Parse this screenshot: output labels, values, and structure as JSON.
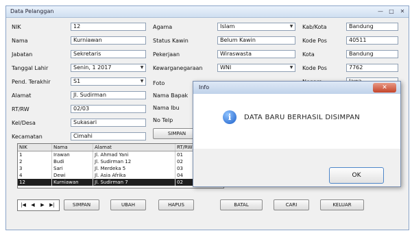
{
  "window": {
    "title": "Data Pelanggan",
    "controls": [
      "—",
      "□",
      "✕"
    ]
  },
  "left_form": {
    "fields": [
      {
        "label": "NIK",
        "value": "12"
      },
      {
        "label": "Nama",
        "value": "Kurniawan"
      },
      {
        "label": "Jabatan",
        "value": "Sekretaris"
      },
      {
        "label": "Tanggal Lahir",
        "value": "Senin, 1 2017"
      },
      {
        "label": "Pend. Terakhir",
        "value": "S1"
      },
      {
        "label": "Alamat",
        "value": "Jl. Sudirman"
      },
      {
        "label": "RT/RW",
        "value": "02/03"
      },
      {
        "label": "Kel/Desa",
        "value": "Sukasari"
      },
      {
        "label": "Kecamatan",
        "value": "Cimahi"
      }
    ]
  },
  "mid_form": {
    "fields": [
      {
        "label": "Agama",
        "value": "Islam"
      },
      {
        "label": "Status Kawin",
        "value": "Belum Kawin"
      },
      {
        "label": "Pekerjaan",
        "value": "Wiraswasta"
      },
      {
        "label": "Kewarganegaraan",
        "value": "WNI"
      },
      {
        "label": "Foto",
        "value": ""
      },
      {
        "label": "Nama Bapak",
        "value": ""
      },
      {
        "label": "Nama Ibu",
        "value": ""
      },
      {
        "label": "No Telp",
        "value": ""
      }
    ],
    "simpan_label": "SIMPAN"
  },
  "right_form": {
    "fields": [
      {
        "label": "Kab/Kota",
        "value": "Bandung"
      },
      {
        "label": "Kode Pos",
        "value": "40511"
      },
      {
        "label": "Kota",
        "value": "Bandung"
      },
      {
        "label": "Kode Pos",
        "value": "7762"
      },
      {
        "label": "Negara",
        "value": "Jawa"
      }
    ]
  },
  "grid": {
    "headers": [
      "NIK",
      "Nama",
      "Alamat",
      "RT/RW"
    ],
    "rows": [
      [
        "1",
        "Irawan",
        "Jl. Ahmad Yani",
        "01"
      ],
      [
        "2",
        "Budi",
        "Jl. Sudirman 12",
        "02"
      ],
      [
        "3",
        "Sari",
        "Jl. Merdeka 5",
        "03"
      ],
      [
        "4",
        "Dewi",
        "Jl. Asia Afrika",
        "04"
      ],
      [
        "12",
        "Kurniawan",
        "Jl. Sudirman 7",
        "02"
      ]
    ]
  },
  "toolbar": {
    "buttons": [
      "SIMPAN",
      "UBAH",
      "HAPUS",
      "BATAL",
      "CARI",
      "KELUAR"
    ]
  },
  "dialog": {
    "title": "Info",
    "close": "✕",
    "icon": "info-icon",
    "message": "DATA BARU BERHASIL DISIMPAN",
    "ok_label": "OK"
  }
}
